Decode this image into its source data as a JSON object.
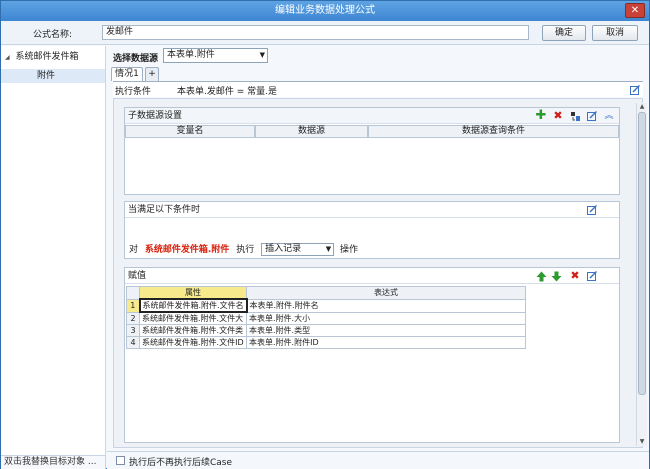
{
  "window": {
    "title": "编辑业务数据处理公式",
    "close_glyph": "✕"
  },
  "top": {
    "formula_label": "公式名称:",
    "formula_name": "发邮件",
    "ok_label": "确定",
    "cancel_label": "取消"
  },
  "sidebar": {
    "tree": [
      {
        "label": "系统邮件发件箱",
        "expanded": true,
        "children": [
          {
            "label": "附件",
            "selected": true
          }
        ]
      }
    ],
    "footer": "双击我替换目标对象  ..."
  },
  "datasource": {
    "label": "选择数据源",
    "value": "本表单.附件"
  },
  "tabs": [
    {
      "label": "情况1",
      "active": true
    },
    {
      "label": "+",
      "active": false
    }
  ],
  "condition": {
    "label": "执行条件",
    "value": "本表单.发邮件 = 常量.是"
  },
  "sub_datasource": {
    "title": "子数据源设置",
    "columns": [
      "变量名",
      "数据源",
      "数据源查询条件"
    ]
  },
  "when_panel": {
    "title": "当满足以下条件时",
    "prefix": "对",
    "target": "系统邮件发件箱.附件",
    "exec_label": "执行",
    "action": "插入记录",
    "suffix": "操作",
    "target_color": "#d9230f"
  },
  "assign": {
    "title": "赋值",
    "columns": [
      "属性",
      "表达式"
    ],
    "rows": [
      {
        "num": "1",
        "prop": "系统邮件发件箱.附件.文件名",
        "expr": "本表单.附件.附件名"
      },
      {
        "num": "2",
        "prop": "系统邮件发件箱.附件.文件大",
        "expr": "本表单.附件.大小"
      },
      {
        "num": "3",
        "prop": "系统邮件发件箱.附件.文件类",
        "expr": "本表单.附件.类型"
      },
      {
        "num": "4",
        "prop": "系统邮件发件箱.附件.文件ID",
        "expr": "本表单.附件.附件ID"
      }
    ]
  },
  "bottom": {
    "checkbox_label": "执行后不再执行后续Case"
  },
  "icons": [
    "add-icon",
    "delete-icon",
    "import-icon",
    "edit-icon",
    "collapse-icon",
    "move-up-icon",
    "move-down-icon"
  ],
  "colors": {
    "add": "#2f9a2f",
    "delete": "#d0201a",
    "edit": "#3a73c5",
    "header_highlight": "#f6ea8c"
  }
}
